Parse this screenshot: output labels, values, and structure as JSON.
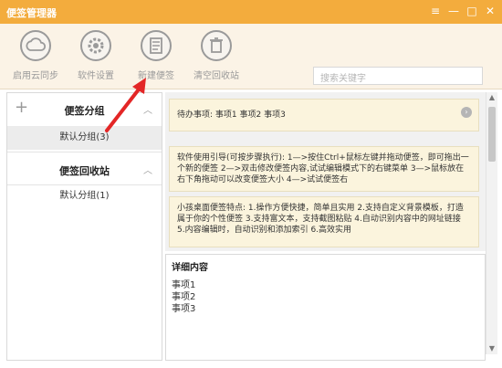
{
  "window": {
    "title": "便签管理器",
    "controls": [
      "≡",
      "—",
      "□",
      "✕"
    ]
  },
  "toolbar": {
    "buttons": [
      {
        "label": "启用云同步",
        "icon": "cloud-icon"
      },
      {
        "label": "软件设置",
        "icon": "gear-icon"
      },
      {
        "label": "新建便签",
        "icon": "new-note-icon"
      },
      {
        "label": "清空回收站",
        "icon": "trash-icon"
      }
    ],
    "search_placeholder": "搜索关键字"
  },
  "sidebar": {
    "groups_title": "便签分组",
    "groups": [
      "默认分组(3)"
    ],
    "recycle_title": "便签回收站",
    "recycle_groups": [
      "默认分组(1)"
    ]
  },
  "notes": [
    {
      "text": "待办事项:  事项1 事项2 事项3"
    },
    {
      "text": "软件使用引导(可按步骤执行):  1—>按住Ctrl+鼠标左键并拖动便签，即可拖出一个新的便签  2—>双击修改便签内容,试试编辑模式下的右键菜单  3—>鼠标放在右下角拖动可以改变便签大小  4—>试试便签右"
    },
    {
      "text": "小孩桌面便签特点: 1.操作方便快捷，简单且实用 2.支持自定义背景模板，打造属于你的个性便签 3.支持富文本，支持截图粘贴 4.自动识别内容中的网址链接 5.内容编辑时，自动识别和添加索引 6.高效实用"
    }
  ],
  "detail": {
    "title": "详细内容",
    "lines": [
      "事项1",
      "事项2",
      "事项3"
    ]
  },
  "colors": {
    "titlebar": "#f3ac3d",
    "toolbar_bg": "#fbf3e6",
    "note_bg": "#fbf4dd",
    "arrow": "#e32626"
  }
}
